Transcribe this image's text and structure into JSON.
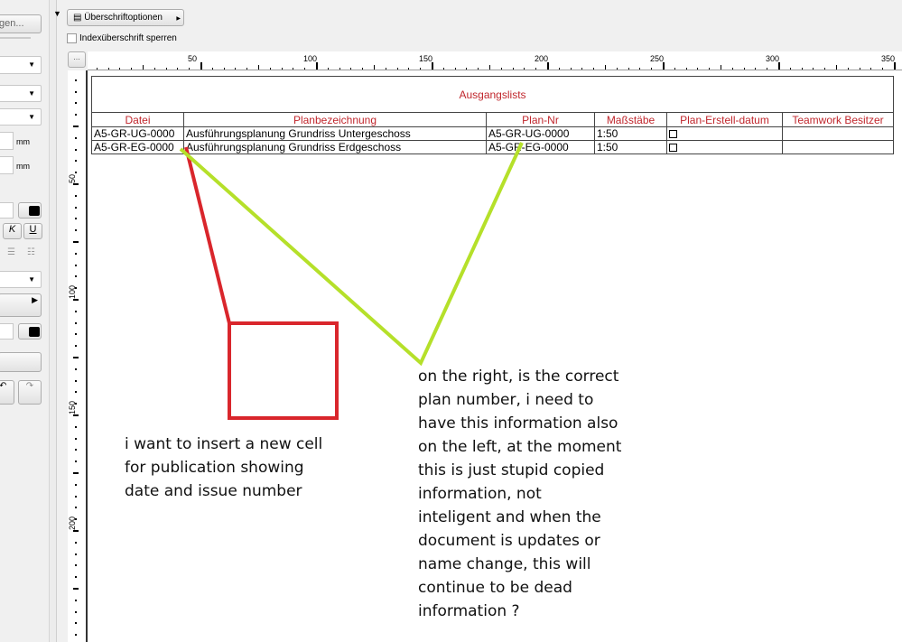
{
  "left_panel": {
    "top_button": "gen...",
    "unit1": "mm",
    "unit2": "mm",
    "italic": "K",
    "underline": "U"
  },
  "toolbar": {
    "heading_options": "Überschriftoptionen",
    "lock_index_heading": "Indexüberschrift sperren",
    "more_button": "..."
  },
  "ruler": {
    "horizontal": [
      "50",
      "100",
      "150",
      "200",
      "250",
      "300",
      "350"
    ],
    "vertical": [
      "50",
      "100",
      "150",
      "200"
    ]
  },
  "table": {
    "title": "Ausgangslists",
    "headers": [
      "Datei",
      "Planbezeichnung",
      "Plan-Nr",
      "Maßstäbe",
      "Plan-Erstell-datum",
      "Teamwork Besitzer"
    ],
    "rows": [
      [
        "A5-GR-UG-0000",
        "Ausführungsplanung Grundriss Untergeschoss",
        "A5-GR-UG-0000",
        "1:50",
        "",
        ""
      ],
      [
        "A5-GR-EG-0000",
        "Ausführungsplanung Grundriss Erdgeschoss",
        "A5-GR-EG-0000",
        "1:50",
        "",
        ""
      ]
    ]
  },
  "annotations": {
    "left_note": "i want to insert a new cell\nfor publication showing\ndate and issue number",
    "right_note": "on the right, is the correct\nplan number, i need to\nhave this information also\non the left, at the moment\nthis is just stupid copied\ninformation, not\ninteligent and when the\ndocument is updates or\nname change, this will\ncontinue to be dead\ninformation ?",
    "colors": {
      "red": "#d9262c",
      "green": "#b5e02a"
    }
  }
}
